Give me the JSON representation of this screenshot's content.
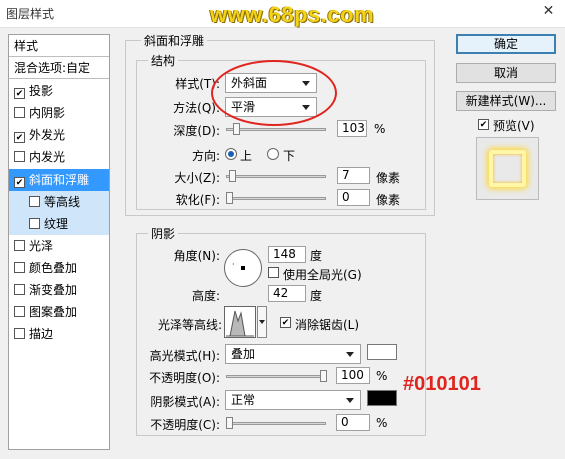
{
  "window": {
    "title": "图层样式",
    "close_glyph": "✕"
  },
  "watermark": "www.68ps.com",
  "style_list": {
    "header": "样式",
    "blend_options": "混合选项:自定",
    "items": [
      {
        "label": "投影",
        "checked": true
      },
      {
        "label": "内阴影",
        "checked": false
      },
      {
        "label": "外发光",
        "checked": true
      },
      {
        "label": "内发光",
        "checked": false
      },
      {
        "label": "斜面和浮雕",
        "checked": true,
        "selected": true
      },
      {
        "label": "等高线",
        "checked": false,
        "sub": true
      },
      {
        "label": "纹理",
        "checked": false,
        "sub": true
      },
      {
        "label": "光泽",
        "checked": false
      },
      {
        "label": "颜色叠加",
        "checked": false
      },
      {
        "label": "渐变叠加",
        "checked": false
      },
      {
        "label": "图案叠加",
        "checked": false
      },
      {
        "label": "描边",
        "checked": false
      }
    ]
  },
  "bevel": {
    "section_title": "斜面和浮雕",
    "structure_title": "结构",
    "style_label": "样式(T):",
    "style_value": "外斜面",
    "technique_label": "方法(Q):",
    "technique_value": "平滑",
    "depth_label": "深度(D):",
    "depth_value": "103",
    "depth_unit": "%",
    "direction_label": "方向:",
    "direction_up": "上",
    "direction_down": "下",
    "size_label": "大小(Z):",
    "size_value": "7",
    "size_unit": "像素",
    "soften_label": "软化(F):",
    "soften_value": "0",
    "soften_unit": "像素"
  },
  "shading": {
    "title": "阴影",
    "angle_label": "角度(N):",
    "angle_value": "148",
    "angle_unit": "度",
    "global_light_label": "使用全局光(G)",
    "altitude_label": "高度:",
    "altitude_value": "42",
    "altitude_unit": "度",
    "gloss_contour_label": "光泽等高线:",
    "anti_aliased_label": "消除锯齿(L)",
    "highlight_mode_label": "高光模式(H):",
    "highlight_mode_value": "叠加",
    "highlight_opacity_label": "不透明度(O):",
    "highlight_opacity_value": "100",
    "highlight_opacity_unit": "%",
    "shadow_mode_label": "阴影模式(A):",
    "shadow_mode_value": "正常",
    "shadow_opacity_label": "不透明度(C):",
    "shadow_opacity_value": "0",
    "shadow_opacity_unit": "%"
  },
  "buttons": {
    "ok": "确定",
    "cancel": "取消",
    "new_style": "新建样式(W)...",
    "preview": "预览(V)"
  },
  "annotation": "#010101",
  "colors": {
    "highlight_swatch": "#ffffff",
    "shadow_swatch": "#010101",
    "annotation": "#e0251f",
    "selection": "#3399ff"
  }
}
